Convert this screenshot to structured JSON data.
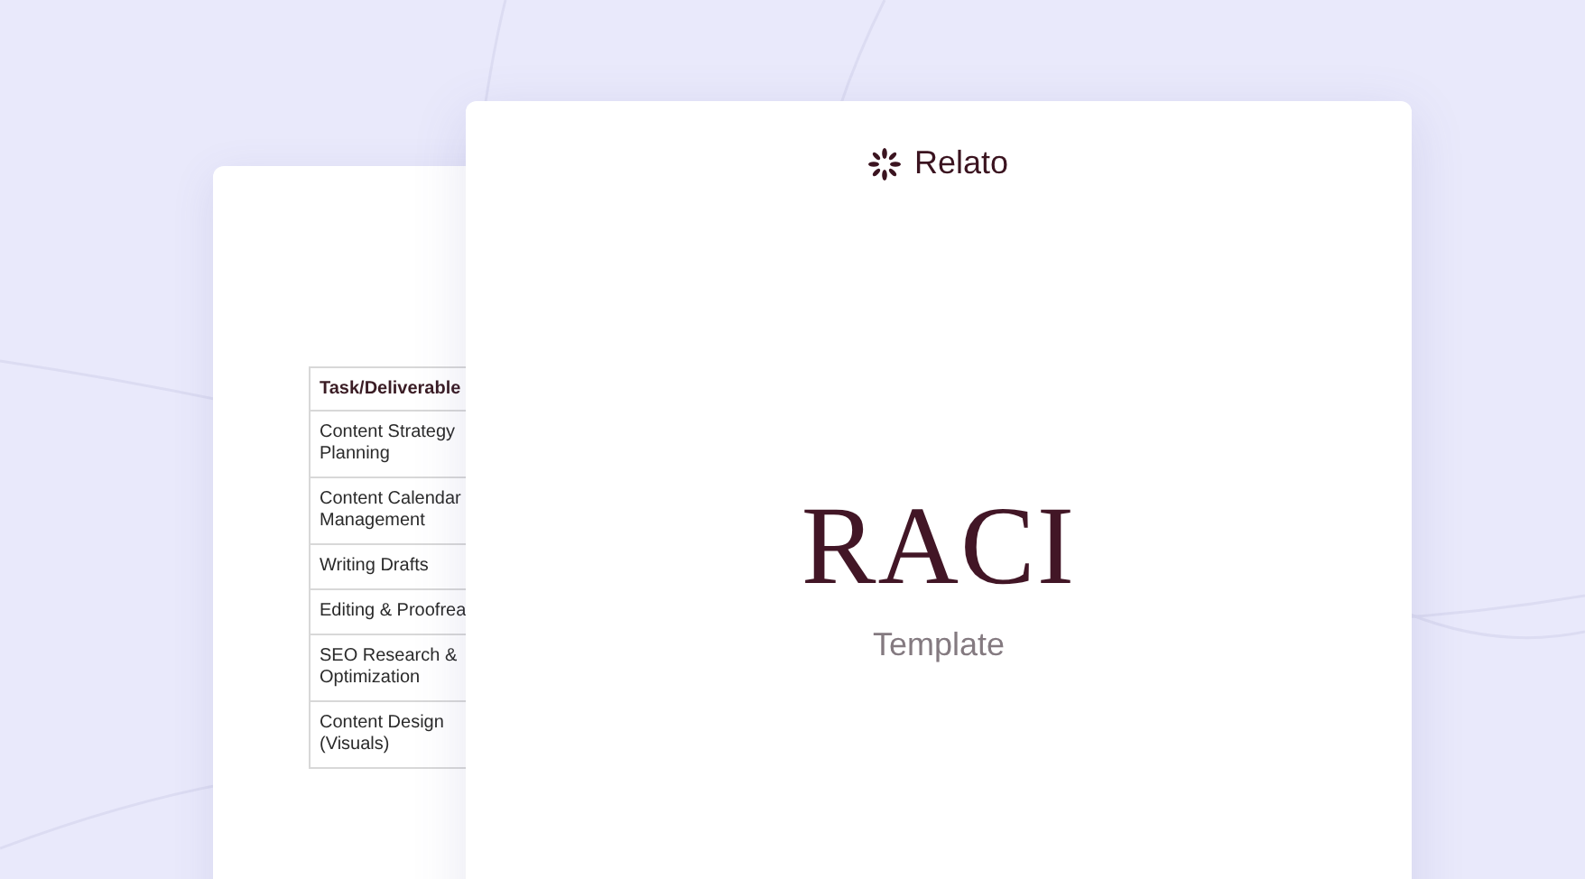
{
  "back_page": {
    "table": {
      "columns": [
        "Task/Deliverable"
      ],
      "rows": [
        "Content Strategy Planning",
        "Content Calendar Management",
        "Writing Drafts",
        "Editing & Proofrea",
        "SEO Research & Optimization",
        "Content Design (Visuals)"
      ]
    }
  },
  "front_page": {
    "logo": "Relato",
    "title": "RACI",
    "subtitle": "Template"
  }
}
